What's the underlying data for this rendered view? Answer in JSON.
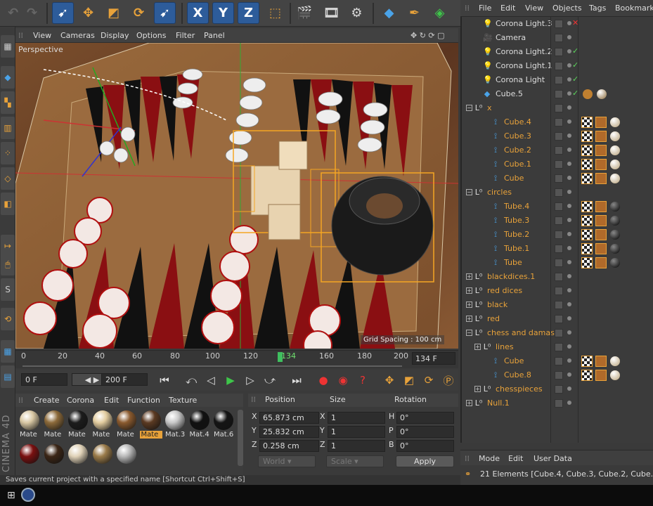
{
  "toolbar": {
    "icons": [
      "undo-icon",
      "redo-icon",
      "live-selection-icon",
      "move-icon",
      "scale-icon",
      "rotate-icon",
      "select-icon",
      "x-axis-icon",
      "y-axis-icon",
      "z-axis-icon",
      "coordinate-system-icon",
      "render-view-icon",
      "render-picture-queue-icon",
      "render-settings-icon",
      "cube-icon",
      "pen-icon",
      "subdivision-icon"
    ],
    "x_label": "X",
    "y_label": "Y",
    "z_label": "Z"
  },
  "viewport": {
    "menu": [
      "View",
      "Cameras",
      "Display",
      "Options",
      "Filter",
      "Panel"
    ],
    "label": "Perspective",
    "grid_spacing": "Grid Spacing : 100 cm"
  },
  "timeline": {
    "ticks": [
      "0",
      "20",
      "40",
      "60",
      "80",
      "100",
      "120",
      "134",
      "160",
      "180",
      "200"
    ],
    "current_frame": "134 F",
    "current": 134,
    "max": 200
  },
  "transport": {
    "start_frame": "0 F",
    "end_frame": "200 F"
  },
  "materials": {
    "menu": [
      "Create",
      "Corona",
      "Edit",
      "Function",
      "Texture"
    ],
    "brand": "CINEMA 4D",
    "items": [
      {
        "label": "Mate",
        "color": "#d9c8a4",
        "selected": false
      },
      {
        "label": "Mate",
        "color": "#8c6a3a",
        "selected": false
      },
      {
        "label": "Mate",
        "color": "#1c1c1c",
        "selected": false
      },
      {
        "label": "Mate",
        "color": "#e3cda0",
        "selected": false
      },
      {
        "label": "Mate",
        "color": "#8a5a2e",
        "selected": false
      },
      {
        "label": "Mate",
        "color": "#5b3a22",
        "selected": true
      },
      {
        "label": "Mat.3",
        "color": "#c8c8c8",
        "selected": false
      },
      {
        "label": "Mat.4",
        "color": "#111111",
        "selected": false
      },
      {
        "label": "Mat.6",
        "color": "#151515",
        "selected": false
      }
    ],
    "row2": [
      "#7a1010",
      "#3b2616",
      "#e0d2b8",
      "#9a7b4a",
      "#b8b8b8"
    ]
  },
  "coordinates": {
    "headers": [
      "Position",
      "Size",
      "Rotation"
    ],
    "rows": [
      {
        "axis": "X",
        "pos": "65.873 cm",
        "size_axis": "X",
        "size": "1",
        "rot_axis": "H",
        "rot": "0°"
      },
      {
        "axis": "Y",
        "pos": "25.832 cm",
        "size_axis": "Y",
        "size": "1",
        "rot_axis": "P",
        "rot": "0°"
      },
      {
        "axis": "Z",
        "pos": "0.258 cm",
        "size_axis": "Z",
        "size": "1",
        "rot_axis": "B",
        "rot": "0°"
      }
    ],
    "mode": "World",
    "size_mode": "Scale",
    "apply": "Apply"
  },
  "status": "Saves current project with a specified name [Shortcut Ctrl+Shift+S]",
  "object_manager": {
    "menu": [
      "File",
      "Edit",
      "View",
      "Objects",
      "Tags",
      "Bookmark"
    ],
    "objects": [
      {
        "name": "Corona Light.3",
        "type": "light",
        "indent": 0,
        "color": "w",
        "state": "x"
      },
      {
        "name": "Camera",
        "type": "camera",
        "indent": 0,
        "color": "w",
        "state": "none"
      },
      {
        "name": "Corona Light.2",
        "type": "light",
        "indent": 0,
        "color": "w",
        "state": "check"
      },
      {
        "name": "Corona Light.1",
        "type": "light",
        "indent": 0,
        "color": "w",
        "state": "check"
      },
      {
        "name": "Corona Light",
        "type": "light",
        "indent": 0,
        "color": "w",
        "state": "check"
      },
      {
        "name": "Cube.5",
        "type": "cube",
        "indent": 0,
        "color": "w",
        "state": "check"
      },
      {
        "name": "x",
        "type": "null",
        "indent": 0,
        "color": "o",
        "state": "none",
        "expander": "−"
      },
      {
        "name": "Cube.4",
        "type": "bone",
        "indent": 1,
        "color": "o",
        "state": "none"
      },
      {
        "name": "Cube.3",
        "type": "bone",
        "indent": 1,
        "color": "o",
        "state": "none"
      },
      {
        "name": "Cube.2",
        "type": "bone",
        "indent": 1,
        "color": "o",
        "state": "none"
      },
      {
        "name": "Cube.1",
        "type": "bone",
        "indent": 1,
        "color": "o",
        "state": "none"
      },
      {
        "name": "Cube",
        "type": "bone",
        "indent": 1,
        "color": "o",
        "state": "none"
      },
      {
        "name": "circles",
        "type": "null",
        "indent": 0,
        "color": "o",
        "state": "none",
        "expander": "−"
      },
      {
        "name": "Tube.4",
        "type": "bone",
        "indent": 1,
        "color": "o",
        "state": "none"
      },
      {
        "name": "Tube.3",
        "type": "bone",
        "indent": 1,
        "color": "o",
        "state": "none"
      },
      {
        "name": "Tube.2",
        "type": "bone",
        "indent": 1,
        "color": "o",
        "state": "none"
      },
      {
        "name": "Tube.1",
        "type": "bone",
        "indent": 1,
        "color": "o",
        "state": "none"
      },
      {
        "name": "Tube",
        "type": "bone",
        "indent": 1,
        "color": "o",
        "state": "none"
      },
      {
        "name": "blackdices.1",
        "type": "null",
        "indent": 0,
        "color": "o",
        "state": "none",
        "expander": "+"
      },
      {
        "name": "red dices",
        "type": "null",
        "indent": 0,
        "color": "o",
        "state": "none",
        "expander": "+"
      },
      {
        "name": "black",
        "type": "null",
        "indent": 0,
        "color": "o",
        "state": "none",
        "expander": "+"
      },
      {
        "name": "red",
        "type": "null",
        "indent": 0,
        "color": "o",
        "state": "none",
        "expander": "+"
      },
      {
        "name": "chess and damas",
        "type": "null",
        "indent": 0,
        "color": "o",
        "state": "none",
        "expander": "−"
      },
      {
        "name": "lines",
        "type": "null",
        "indent": 1,
        "color": "o",
        "state": "none",
        "expander": "+"
      },
      {
        "name": "Cube",
        "type": "bone",
        "indent": 1,
        "color": "o",
        "state": "none"
      },
      {
        "name": "Cube.8",
        "type": "bone",
        "indent": 1,
        "color": "o",
        "state": "none"
      },
      {
        "name": "chesspieces",
        "type": "null",
        "indent": 1,
        "color": "o",
        "state": "none",
        "expander": "+"
      },
      {
        "name": "Null.1",
        "type": "null",
        "indent": 0,
        "color": "o",
        "state": "none",
        "expander": "+"
      }
    ]
  },
  "attribute_manager": {
    "menu": [
      "Mode",
      "Edit",
      "User Data"
    ],
    "info": "21 Elements [Cube.4, Cube.3, Cube.2, Cube.1, Cu"
  }
}
